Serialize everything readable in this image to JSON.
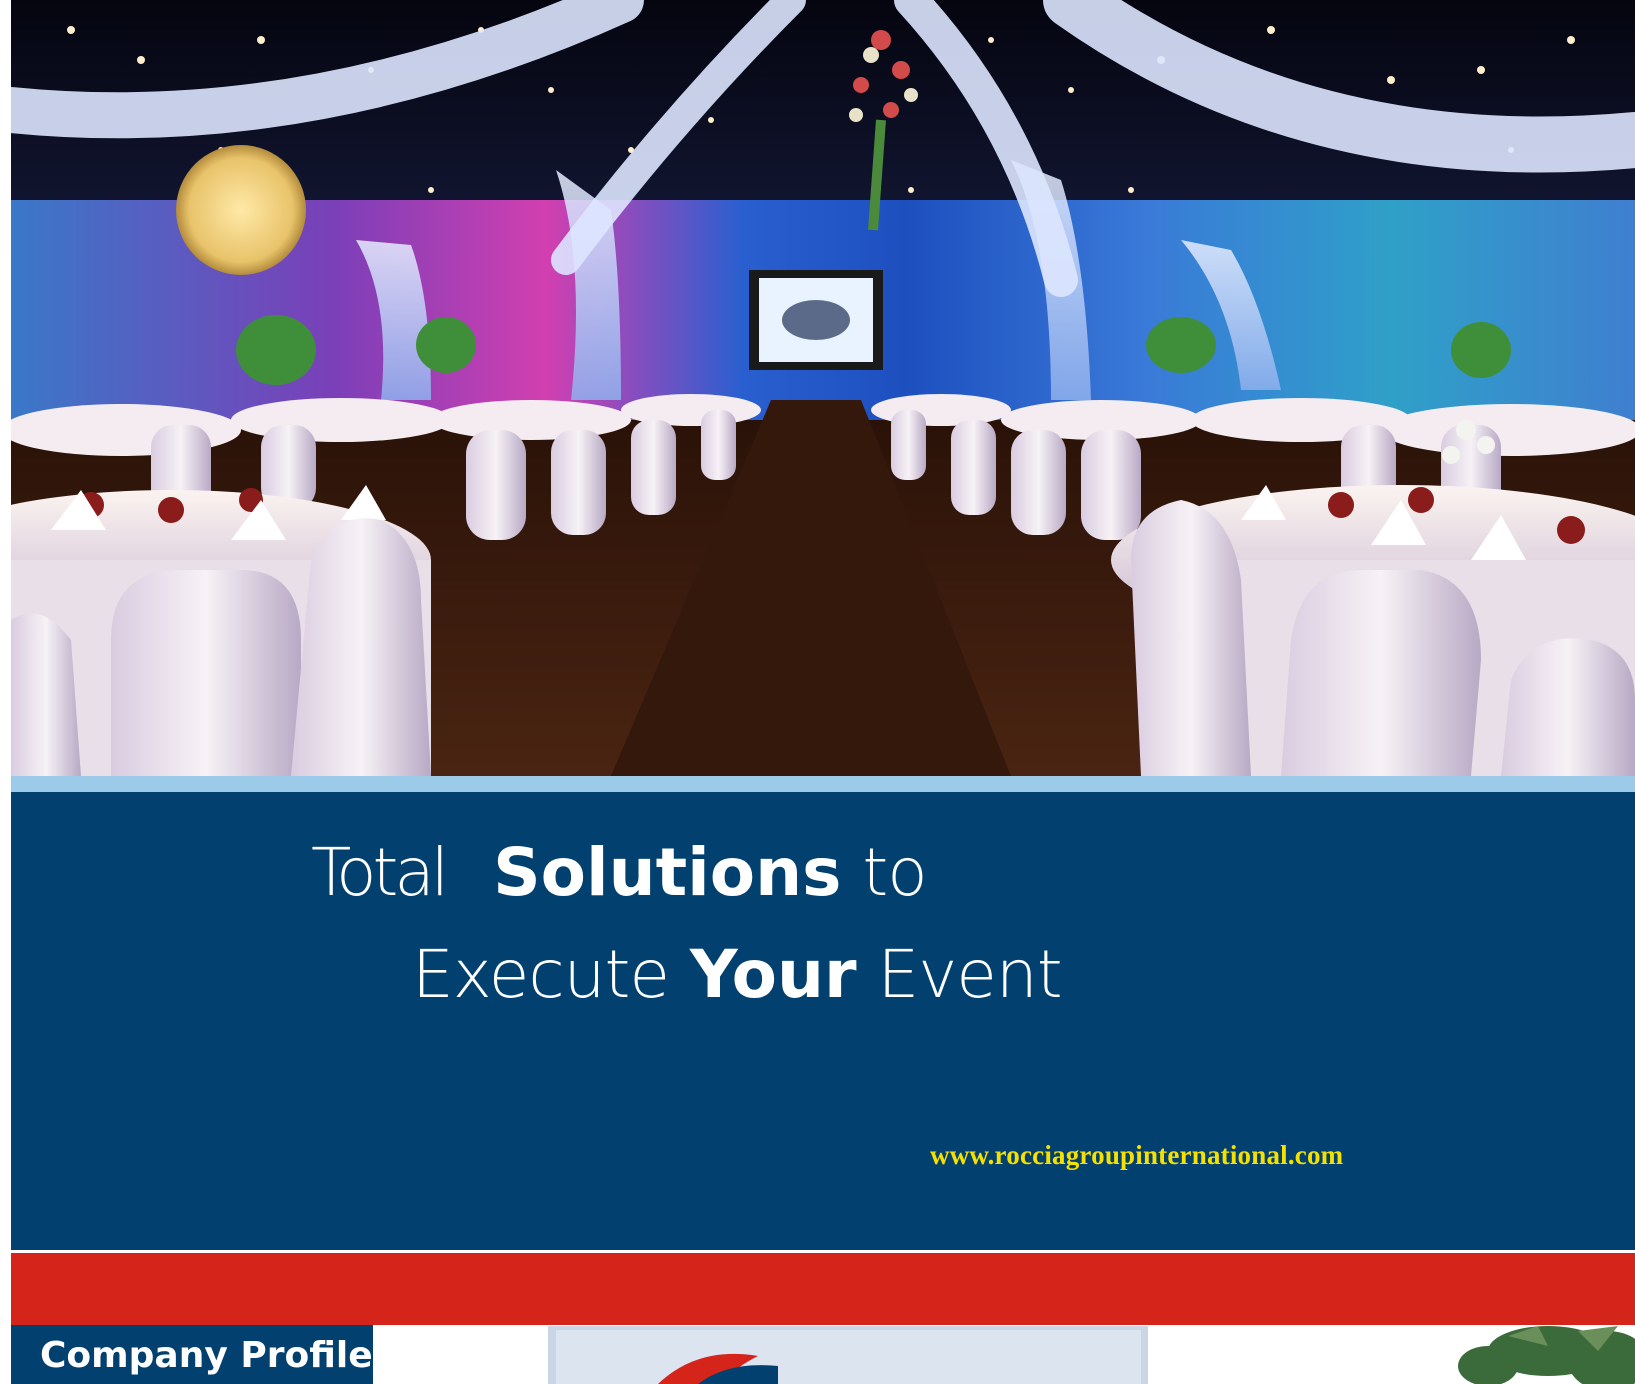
{
  "headline": {
    "line1": {
      "word1": "Total",
      "word2": "Solutions",
      "word3": "to"
    },
    "line2": {
      "word1": "Execute",
      "word2": "Your",
      "word3": "Event"
    }
  },
  "website": "www.rocciagroupinternational.com",
  "section_tab": {
    "label": "Company Profile"
  },
  "colors": {
    "navy_band": "#02416f",
    "accent_light_blue": "#9ccbea",
    "red_band": "#d5251b",
    "website_yellow": "#f5e000"
  }
}
